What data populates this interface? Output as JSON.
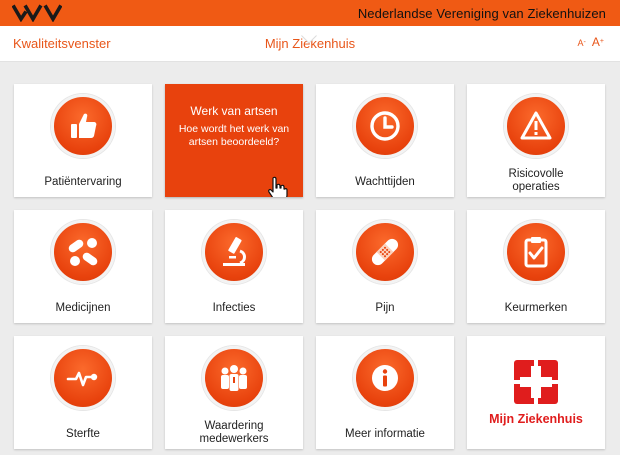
{
  "header": {
    "logo_icon": "nvz-logo-icon",
    "org_title": "Nederlandse Vereniging van Ziekenhuizen",
    "brand_color": "#f05a14"
  },
  "nav": {
    "left_label": "Kwaliteitsvenster",
    "center_label": "Mijn Ziekenhuis",
    "font_small": "A",
    "font_small_sign": "-",
    "font_large": "A",
    "font_large_sign": "+"
  },
  "tiles": [
    {
      "label": "Patiëntervaring",
      "icon": "thumbs-up-icon"
    },
    {
      "title": "Werk van artsen",
      "description": "Hoe wordt het werk van artsen beoordeeld?",
      "icon": "hand-cursor-icon",
      "state": "hover"
    },
    {
      "label": "Wachttijden",
      "icon": "clock-icon"
    },
    {
      "label": "Risicovolle operaties",
      "icon": "warning-icon"
    },
    {
      "label": "Medicijnen",
      "icon": "pills-icon"
    },
    {
      "label": "Infecties",
      "icon": "microscope-icon"
    },
    {
      "label": "Pijn",
      "icon": "bandage-icon"
    },
    {
      "label": "Keurmerken",
      "icon": "clipboard-check-icon"
    },
    {
      "label": "Sterfte",
      "icon": "heartbeat-icon"
    },
    {
      "label": "Waardering medewerkers",
      "icon": "staff-group-icon"
    },
    {
      "label": "Meer informatie",
      "icon": "info-icon"
    },
    {
      "label": "Mijn Ziekenhuis",
      "icon": "hospital-cross-icon",
      "color": "#e01d1d"
    }
  ],
  "colors": {
    "accent": "#e8561a",
    "tile_orange": "#e8420d",
    "background": "#ececec",
    "hospital_red": "#e01d1d"
  }
}
